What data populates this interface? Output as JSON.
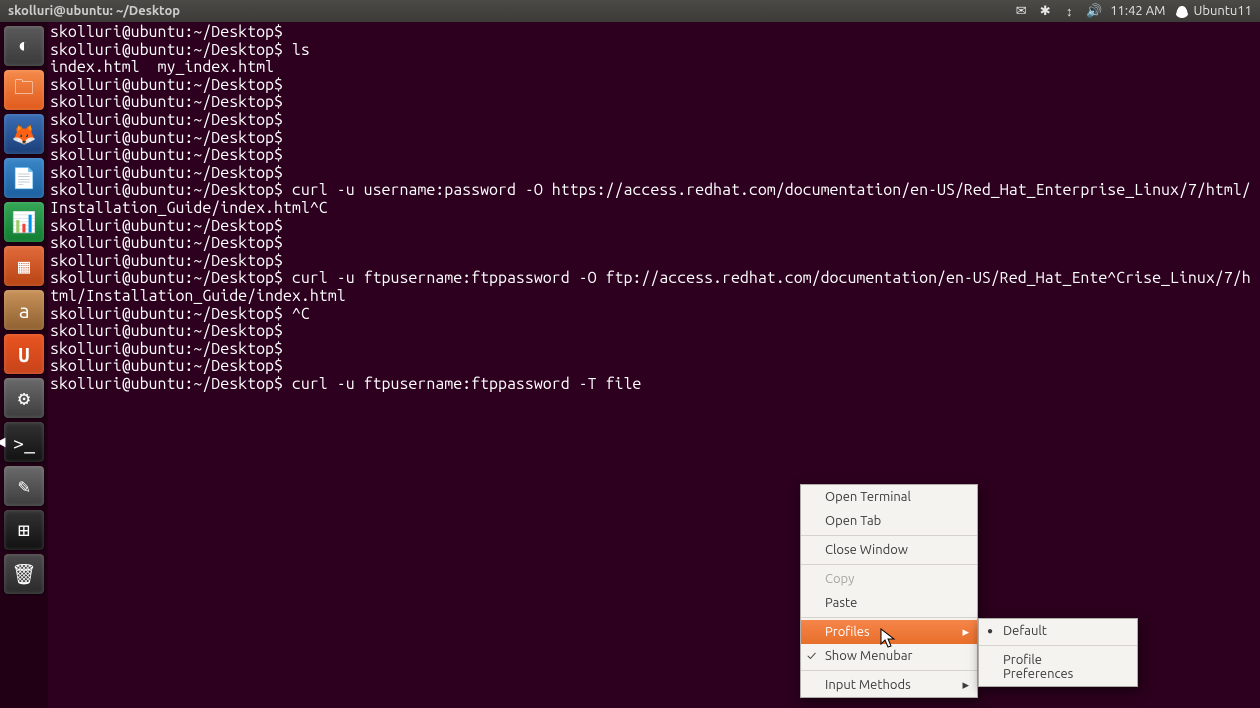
{
  "top_panel": {
    "title": "skolluri@ubuntu: ~/Desktop",
    "indicators": {
      "mail": "✉",
      "bluetooth": "✱",
      "network": "↕",
      "volume": "🔊",
      "time": "11:42 AM",
      "user_label": "Ubuntu11"
    }
  },
  "launcher": [
    {
      "name": "dash",
      "label": "◐",
      "cls": "li-dash"
    },
    {
      "name": "files",
      "label": "🗀",
      "cls": "li-files"
    },
    {
      "name": "firefox",
      "label": "🦊",
      "cls": "li-ff"
    },
    {
      "name": "writer",
      "label": "📄",
      "cls": "li-writer"
    },
    {
      "name": "calc",
      "label": "📊",
      "cls": "li-calc"
    },
    {
      "name": "impress",
      "label": "▦",
      "cls": "li-imp"
    },
    {
      "name": "amazon",
      "label": "a",
      "cls": "li-amz"
    },
    {
      "name": "software",
      "label": "U",
      "cls": "li-sw"
    },
    {
      "name": "settings",
      "label": "⚙",
      "cls": "li-set"
    },
    {
      "name": "terminal",
      "label": ">_",
      "cls": "li-term",
      "active": true
    },
    {
      "name": "editor",
      "label": "✎",
      "cls": "li-edit"
    },
    {
      "name": "workspaces",
      "label": "⊞",
      "cls": "li-ws"
    },
    {
      "name": "trash",
      "label": "🗑",
      "cls": "li-trash"
    }
  ],
  "terminal": {
    "prompt": "skolluri@ubuntu:~/Desktop$",
    "lines": [
      {
        "type": "prompt",
        "cmd": ""
      },
      {
        "type": "prompt",
        "cmd": " ls"
      },
      {
        "type": "out",
        "text": "index.html  my_index.html"
      },
      {
        "type": "prompt",
        "cmd": ""
      },
      {
        "type": "prompt",
        "cmd": ""
      },
      {
        "type": "prompt",
        "cmd": ""
      },
      {
        "type": "prompt",
        "cmd": ""
      },
      {
        "type": "prompt",
        "cmd": ""
      },
      {
        "type": "prompt",
        "cmd": ""
      },
      {
        "type": "prompt",
        "cmd": " curl -u username:password -O https://access.redhat.com/documentation/en-US/Red_Hat_Enterprise_Linux/7/html/Installation_Guide/index.html^C"
      },
      {
        "type": "prompt",
        "cmd": ""
      },
      {
        "type": "prompt",
        "cmd": ""
      },
      {
        "type": "prompt",
        "cmd": ""
      },
      {
        "type": "prompt",
        "cmd": " curl -u ftpusername:ftppassword -O ftp://access.redhat.com/documentation/en-US/Red_Hat_Ente^Crise_Linux/7/html/Installation_Guide/index.html"
      },
      {
        "type": "prompt",
        "cmd": " ^C"
      },
      {
        "type": "prompt",
        "cmd": ""
      },
      {
        "type": "prompt",
        "cmd": ""
      },
      {
        "type": "prompt",
        "cmd": ""
      },
      {
        "type": "prompt",
        "cmd": " curl -u ftpusername:ftppassword -T file"
      }
    ]
  },
  "context_menu": {
    "items": [
      {
        "label": "Open Terminal"
      },
      {
        "label": "Open Tab"
      },
      {
        "sep": true
      },
      {
        "label": "Close Window"
      },
      {
        "sep": true
      },
      {
        "label": "Copy",
        "disabled": true
      },
      {
        "label": "Paste"
      },
      {
        "sep": true
      },
      {
        "label": "Profiles",
        "hover": true,
        "submenu": true
      },
      {
        "label": "Show Menubar",
        "checked": true
      },
      {
        "sep": true
      },
      {
        "label": "Input Methods",
        "submenu": true
      }
    ],
    "submenu": {
      "items": [
        {
          "label": "Default",
          "radio": true
        },
        {
          "sep": true
        },
        {
          "label": "Profile Preferences"
        }
      ]
    }
  }
}
